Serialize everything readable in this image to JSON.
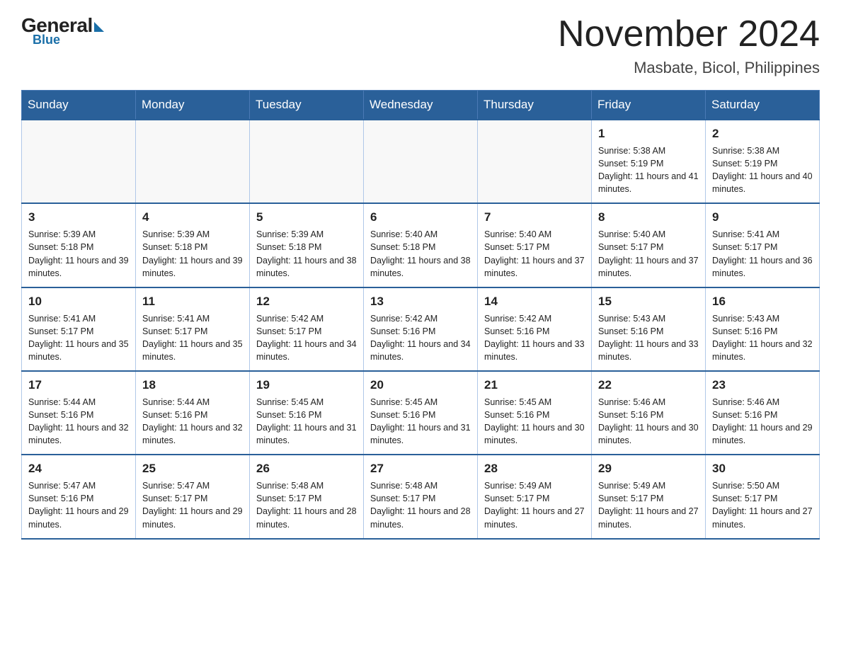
{
  "header": {
    "logo": {
      "general": "General",
      "blue": "Blue"
    },
    "title": "November 2024",
    "location": "Masbate, Bicol, Philippines"
  },
  "days_of_week": [
    "Sunday",
    "Monday",
    "Tuesday",
    "Wednesday",
    "Thursday",
    "Friday",
    "Saturday"
  ],
  "weeks": [
    [
      {
        "day": "",
        "info": ""
      },
      {
        "day": "",
        "info": ""
      },
      {
        "day": "",
        "info": ""
      },
      {
        "day": "",
        "info": ""
      },
      {
        "day": "",
        "info": ""
      },
      {
        "day": "1",
        "info": "Sunrise: 5:38 AM\nSunset: 5:19 PM\nDaylight: 11 hours and 41 minutes."
      },
      {
        "day": "2",
        "info": "Sunrise: 5:38 AM\nSunset: 5:19 PM\nDaylight: 11 hours and 40 minutes."
      }
    ],
    [
      {
        "day": "3",
        "info": "Sunrise: 5:39 AM\nSunset: 5:18 PM\nDaylight: 11 hours and 39 minutes."
      },
      {
        "day": "4",
        "info": "Sunrise: 5:39 AM\nSunset: 5:18 PM\nDaylight: 11 hours and 39 minutes."
      },
      {
        "day": "5",
        "info": "Sunrise: 5:39 AM\nSunset: 5:18 PM\nDaylight: 11 hours and 38 minutes."
      },
      {
        "day": "6",
        "info": "Sunrise: 5:40 AM\nSunset: 5:18 PM\nDaylight: 11 hours and 38 minutes."
      },
      {
        "day": "7",
        "info": "Sunrise: 5:40 AM\nSunset: 5:17 PM\nDaylight: 11 hours and 37 minutes."
      },
      {
        "day": "8",
        "info": "Sunrise: 5:40 AM\nSunset: 5:17 PM\nDaylight: 11 hours and 37 minutes."
      },
      {
        "day": "9",
        "info": "Sunrise: 5:41 AM\nSunset: 5:17 PM\nDaylight: 11 hours and 36 minutes."
      }
    ],
    [
      {
        "day": "10",
        "info": "Sunrise: 5:41 AM\nSunset: 5:17 PM\nDaylight: 11 hours and 35 minutes."
      },
      {
        "day": "11",
        "info": "Sunrise: 5:41 AM\nSunset: 5:17 PM\nDaylight: 11 hours and 35 minutes."
      },
      {
        "day": "12",
        "info": "Sunrise: 5:42 AM\nSunset: 5:17 PM\nDaylight: 11 hours and 34 minutes."
      },
      {
        "day": "13",
        "info": "Sunrise: 5:42 AM\nSunset: 5:16 PM\nDaylight: 11 hours and 34 minutes."
      },
      {
        "day": "14",
        "info": "Sunrise: 5:42 AM\nSunset: 5:16 PM\nDaylight: 11 hours and 33 minutes."
      },
      {
        "day": "15",
        "info": "Sunrise: 5:43 AM\nSunset: 5:16 PM\nDaylight: 11 hours and 33 minutes."
      },
      {
        "day": "16",
        "info": "Sunrise: 5:43 AM\nSunset: 5:16 PM\nDaylight: 11 hours and 32 minutes."
      }
    ],
    [
      {
        "day": "17",
        "info": "Sunrise: 5:44 AM\nSunset: 5:16 PM\nDaylight: 11 hours and 32 minutes."
      },
      {
        "day": "18",
        "info": "Sunrise: 5:44 AM\nSunset: 5:16 PM\nDaylight: 11 hours and 32 minutes."
      },
      {
        "day": "19",
        "info": "Sunrise: 5:45 AM\nSunset: 5:16 PM\nDaylight: 11 hours and 31 minutes."
      },
      {
        "day": "20",
        "info": "Sunrise: 5:45 AM\nSunset: 5:16 PM\nDaylight: 11 hours and 31 minutes."
      },
      {
        "day": "21",
        "info": "Sunrise: 5:45 AM\nSunset: 5:16 PM\nDaylight: 11 hours and 30 minutes."
      },
      {
        "day": "22",
        "info": "Sunrise: 5:46 AM\nSunset: 5:16 PM\nDaylight: 11 hours and 30 minutes."
      },
      {
        "day": "23",
        "info": "Sunrise: 5:46 AM\nSunset: 5:16 PM\nDaylight: 11 hours and 29 minutes."
      }
    ],
    [
      {
        "day": "24",
        "info": "Sunrise: 5:47 AM\nSunset: 5:16 PM\nDaylight: 11 hours and 29 minutes."
      },
      {
        "day": "25",
        "info": "Sunrise: 5:47 AM\nSunset: 5:17 PM\nDaylight: 11 hours and 29 minutes."
      },
      {
        "day": "26",
        "info": "Sunrise: 5:48 AM\nSunset: 5:17 PM\nDaylight: 11 hours and 28 minutes."
      },
      {
        "day": "27",
        "info": "Sunrise: 5:48 AM\nSunset: 5:17 PM\nDaylight: 11 hours and 28 minutes."
      },
      {
        "day": "28",
        "info": "Sunrise: 5:49 AM\nSunset: 5:17 PM\nDaylight: 11 hours and 27 minutes."
      },
      {
        "day": "29",
        "info": "Sunrise: 5:49 AM\nSunset: 5:17 PM\nDaylight: 11 hours and 27 minutes."
      },
      {
        "day": "30",
        "info": "Sunrise: 5:50 AM\nSunset: 5:17 PM\nDaylight: 11 hours and 27 minutes."
      }
    ]
  ]
}
